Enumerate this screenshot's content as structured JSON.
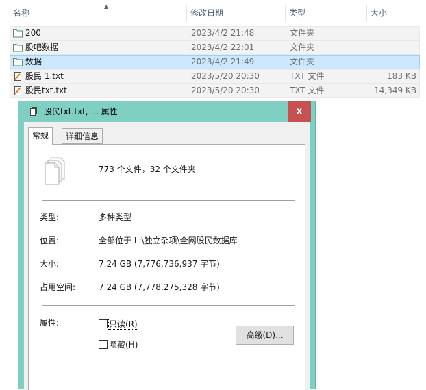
{
  "explorer": {
    "columns": {
      "name": "名称",
      "date": "修改日期",
      "type": "类型",
      "size": "大小"
    },
    "rows": [
      {
        "icon": "folder-icon",
        "name": "200",
        "date": "2023/4/2 21:48",
        "type": "文件夹",
        "size": "",
        "selected": false
      },
      {
        "icon": "folder-icon",
        "name": "股吧数据",
        "date": "2023/4/2 22:01",
        "type": "文件夹",
        "size": "",
        "selected": false
      },
      {
        "icon": "folder-icon",
        "name": "数据",
        "date": "2023/4/2 21:49",
        "type": "文件夹",
        "size": "",
        "selected": true
      },
      {
        "icon": "text-file-icon",
        "name": "股民 1.txt",
        "date": "2023/5/20 20:30",
        "type": "TXT 文件",
        "size": "183 KB",
        "selected": false
      },
      {
        "icon": "text-file-icon",
        "name": "股民txt.txt",
        "date": "2023/5/20 20:30",
        "type": "TXT 文件",
        "size": "14,349 KB",
        "selected": false
      }
    ]
  },
  "dialog": {
    "title": "股民txt.txt, ... 属性",
    "close_glyph": "x",
    "tabs": [
      "常规",
      "详细信息"
    ],
    "summary": "773 个文件，32 个文件夹",
    "fields": {
      "type_label": "类型:",
      "type_value": "多种类型",
      "location_label": "位置:",
      "location_value": "全部位于 L:\\独立杂项\\全网股民数据库",
      "size_label": "大小:",
      "size_value": "7.24 GB (7,776,736,937 字节)",
      "disk_label": "占用空间:",
      "disk_value": "7.24 GB (7,778,275,328 字节)"
    },
    "attributes": {
      "label": "属性:",
      "readonly": "只读(R)",
      "hidden": "隐藏(H)",
      "advanced": "高级(D)..."
    }
  },
  "colors": {
    "selection": "#cce8ff",
    "dialog_frame": "#7fcfc3",
    "close_button": "#c75050",
    "header_text": "#4c607a"
  }
}
